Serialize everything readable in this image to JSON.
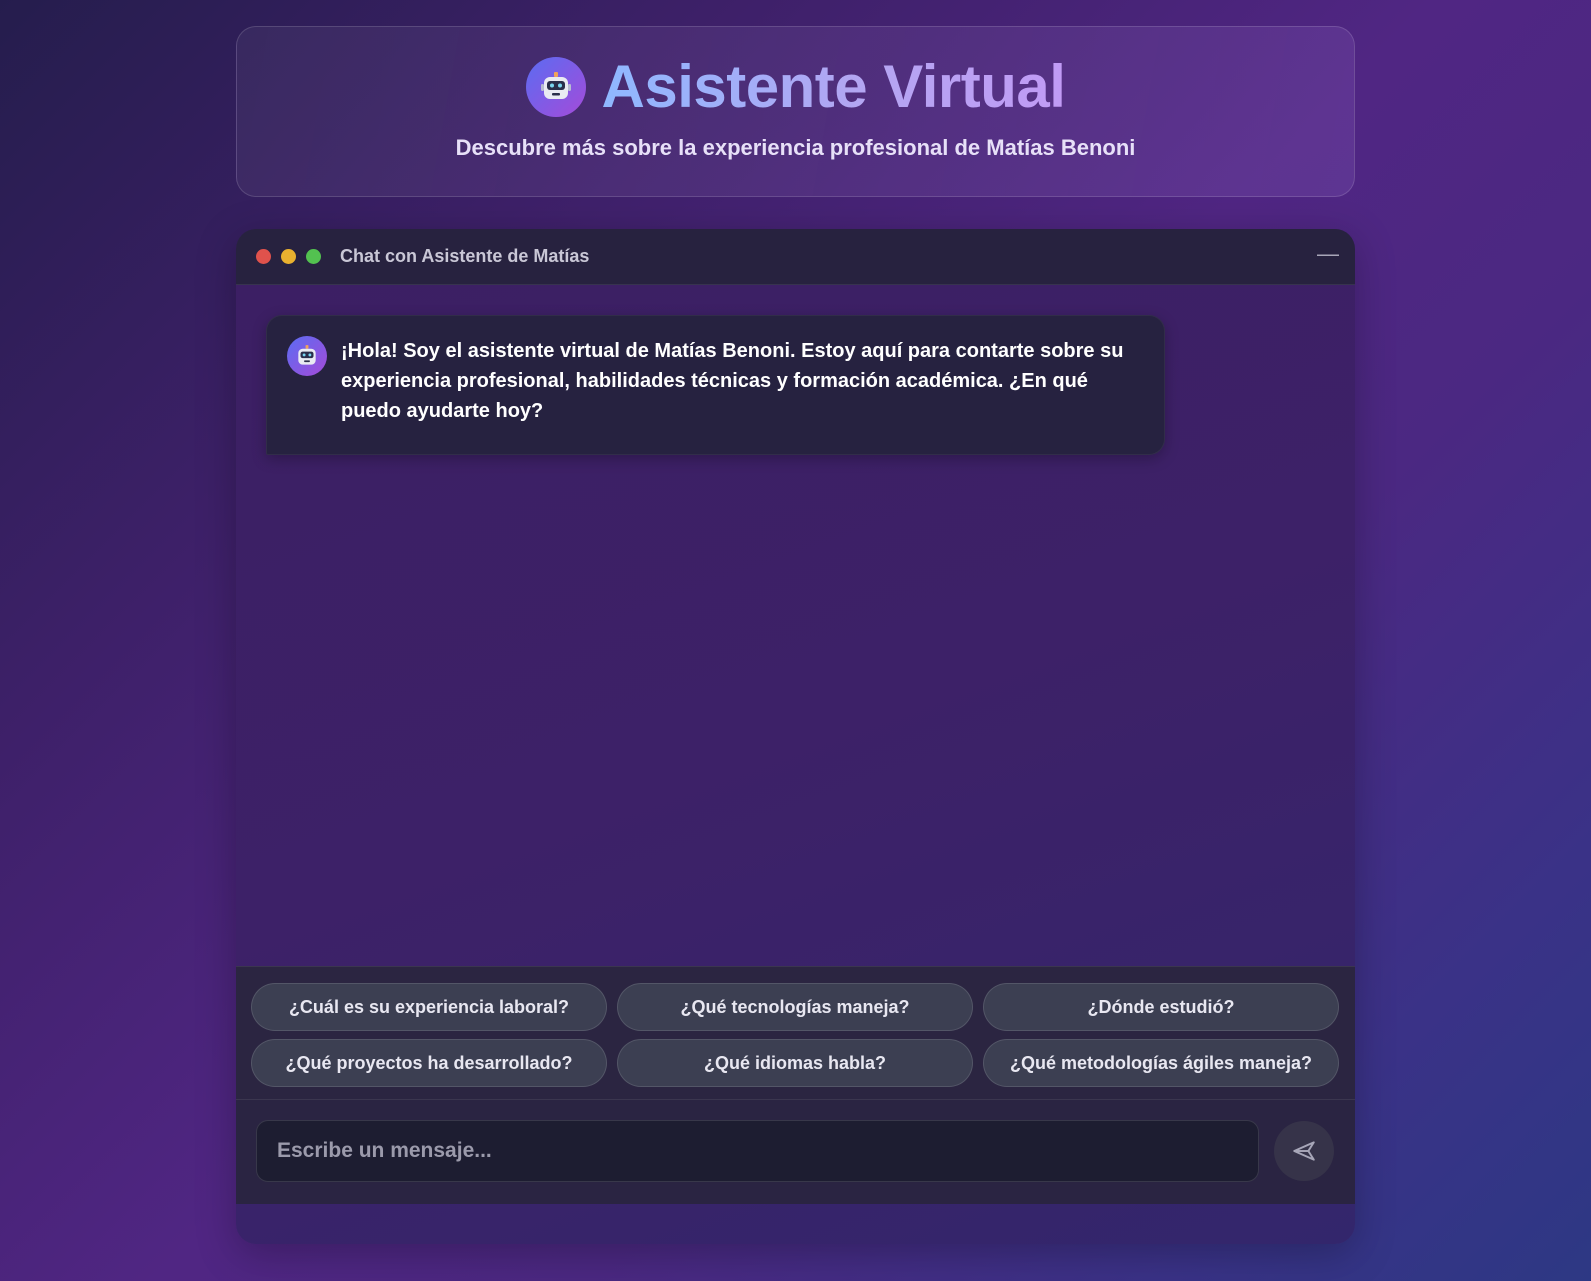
{
  "header": {
    "title": "Asistente Virtual",
    "subtitle": "Descubre más sobre la experiencia profesional de Matías Benoni",
    "logo_icon": "robot-icon"
  },
  "chat": {
    "window_title": "Chat con Asistente de Matías",
    "minimize_label": "—",
    "messages": [
      {
        "sender": "bot",
        "avatar_icon": "robot-icon",
        "text": "¡Hola! Soy el asistente virtual de Matías Benoni. Estoy aquí para contarte sobre su experiencia profesional, habilidades técnicas y formación académica. ¿En qué puedo ayudarte hoy?"
      }
    ],
    "suggestions": [
      "¿Cuál es su experiencia laboral?",
      "¿Qué tecnologías maneja?",
      "¿Dónde estudió?",
      "¿Qué proyectos ha desarrollado?",
      "¿Qué idiomas habla?",
      "¿Qué metodologías ágiles maneja?"
    ],
    "input": {
      "placeholder": "Escribe un mensaje...",
      "value": ""
    },
    "send_icon": "send-icon"
  },
  "colors": {
    "dot_red": "#e0524c",
    "dot_yellow": "#e9b12f",
    "dot_green": "#53c150",
    "accent_gradient_start": "#5b6cf2",
    "accent_gradient_end": "#a44bd9"
  }
}
